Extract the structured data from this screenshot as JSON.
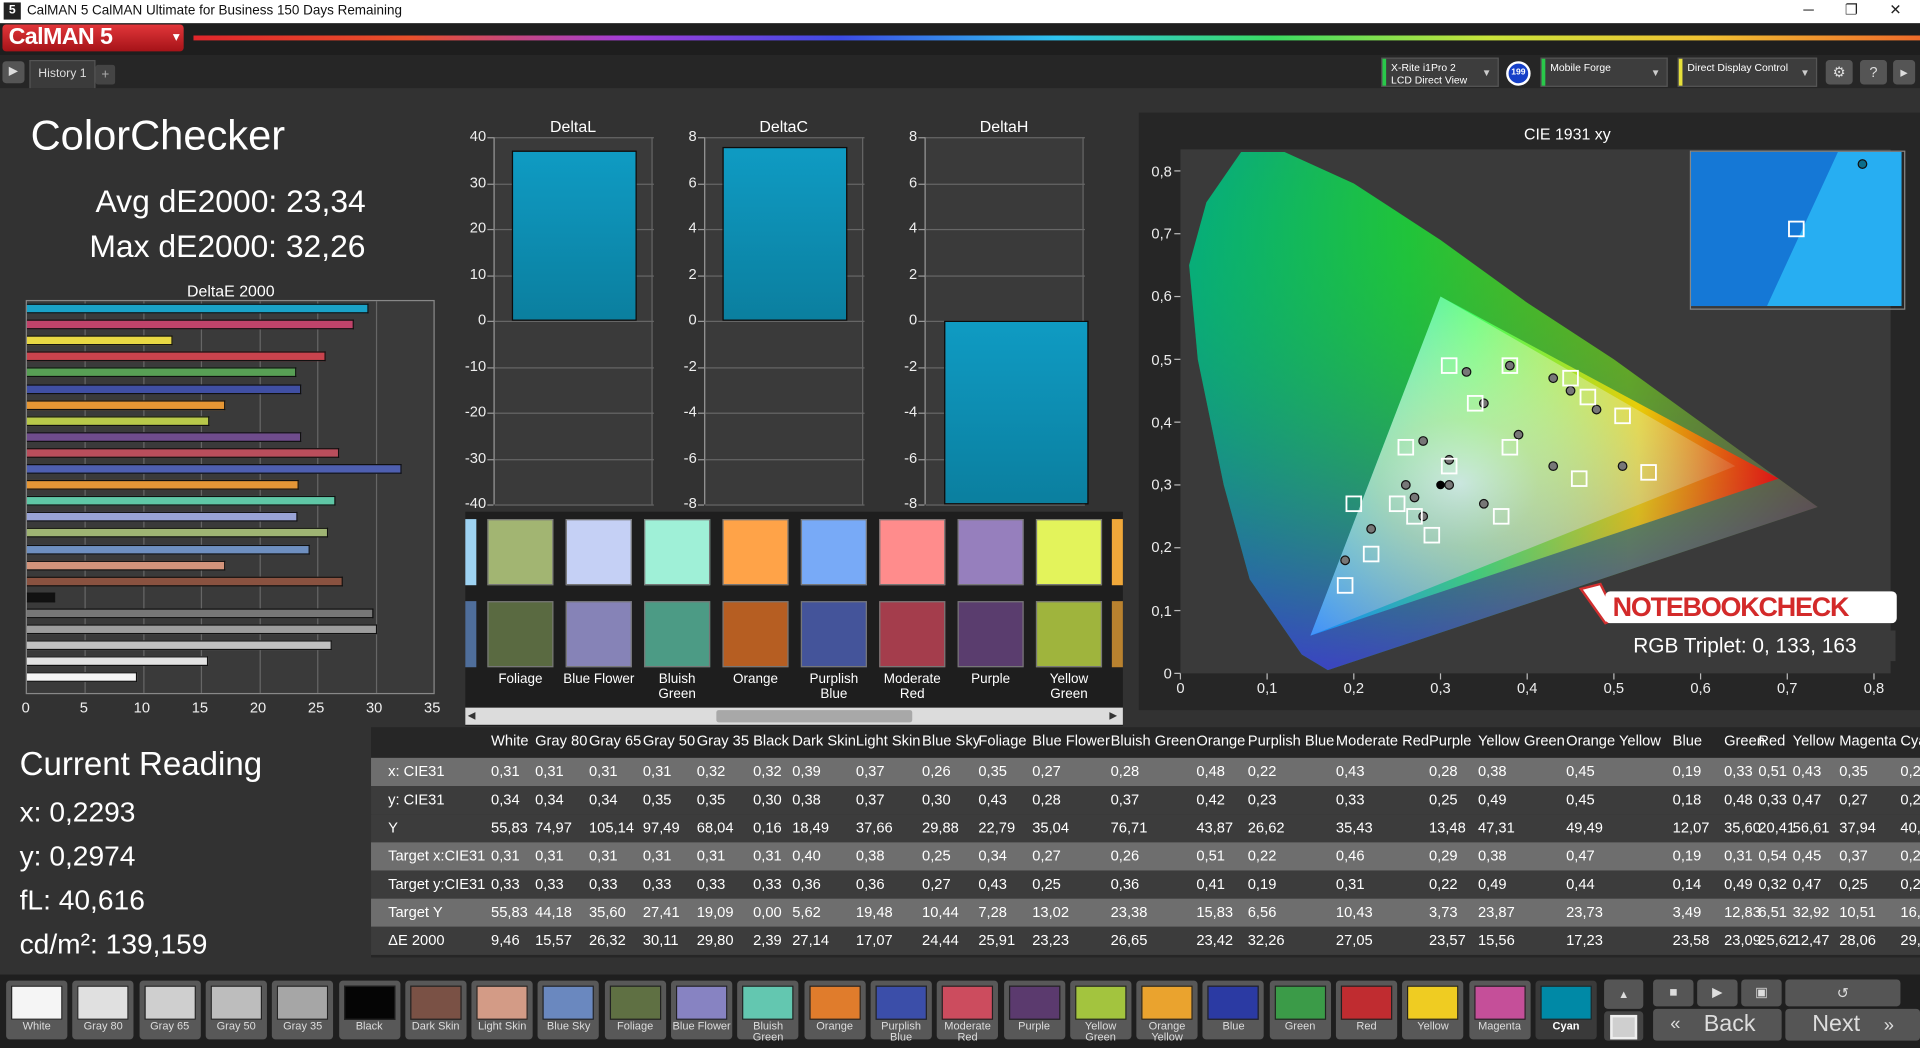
{
  "window": {
    "title": "CalMAN 5 CalMAN Ultimate for Business 150 Days Remaining",
    "minimize": "─",
    "maximize": "❐",
    "close": "✕"
  },
  "brand": {
    "name": "CalMAN 5",
    "dropdown": "▾"
  },
  "tabs": {
    "play": "▶",
    "history": "History 1",
    "add": "+"
  },
  "devices": [
    {
      "line1": "X-Rite i1Pro 2",
      "line2": "LCD Direct View",
      "color": "#29c94a"
    },
    {
      "line1": "Mobile Forge",
      "line2": "",
      "color": "#29c94a"
    },
    {
      "line1": "Direct Display Control",
      "line2": "",
      "color": "#e6e03a"
    }
  ],
  "device_badge": "199",
  "toolbar_icons": {
    "settings": "⚙",
    "help": "?",
    "expand": "▸"
  },
  "page": {
    "title": "ColorChecker",
    "avg": "Avg dE2000: 23,34",
    "max": "Max dE2000: 32,26"
  },
  "current_reading": {
    "title": "Current Reading",
    "x": "x: 0,2293",
    "y": "y: 0,2974",
    "fl": "fL: 40,616",
    "cd": "cd/m²: 139,159"
  },
  "colors": {
    "accent_bar": "#0f9bc3",
    "brand_red": "#d8262c",
    "selected": "#0089a6"
  },
  "deltae_chart": {
    "type": "bar",
    "title": "DeltaE 2000",
    "xlim": [
      0,
      35
    ],
    "xticks": [
      "0",
      "5",
      "10",
      "15",
      "20",
      "25",
      "30",
      "35"
    ],
    "values": [
      29.4,
      28.1,
      12.5,
      25.7,
      23.2,
      23.6,
      17.1,
      15.7,
      23.6,
      26.9,
      32.3,
      23.4,
      26.6,
      23.3,
      25.9,
      24.4,
      17.1,
      27.2,
      2.39,
      29.8,
      30.1,
      26.3,
      15.6,
      9.5
    ],
    "bar_colors": [
      "#1aa2c7",
      "#c0436a",
      "#e8d844",
      "#c9434d",
      "#58a055",
      "#404fa3",
      "#e69634",
      "#b8c84a",
      "#6f4c8c",
      "#b94e5c",
      "#4e5fb0",
      "#e59636",
      "#5fc7a6",
      "#99a3d6",
      "#9fb473",
      "#6e8fc0",
      "#d4947b",
      "#8a5240",
      "#111111",
      "#777777",
      "#9d9d9d",
      "#c0c0c0",
      "#e2e2e2",
      "#f5f5f5"
    ]
  },
  "chart_data": [
    {
      "type": "bar",
      "title": "DeltaL",
      "categories": [
        "Cyan"
      ],
      "values": [
        37
      ],
      "ylim": [
        -40,
        40
      ],
      "yticks": [
        "40",
        "30",
        "20",
        "10",
        "0",
        "-10",
        "-20",
        "-30",
        "-40"
      ]
    },
    {
      "type": "bar",
      "title": "DeltaC",
      "categories": [
        "Cyan"
      ],
      "values": [
        7.6
      ],
      "ylim": [
        -8,
        8
      ],
      "yticks": [
        "8",
        "6",
        "4",
        "2",
        "0",
        "-2",
        "-4",
        "-6",
        "-8"
      ]
    },
    {
      "type": "bar",
      "title": "DeltaH",
      "categories": [
        "Cyan"
      ],
      "values": [
        -8
      ],
      "ylim": [
        -8,
        8
      ],
      "yticks": [
        "8",
        "6",
        "4",
        "2",
        "0",
        "-2",
        "-4",
        "-6",
        "-8"
      ]
    }
  ],
  "cie": {
    "title": "CIE 1931 xy",
    "xticks": [
      "0",
      "0,1",
      "0,2",
      "0,3",
      "0,4",
      "0,5",
      "0,6",
      "0,7",
      "0,8"
    ],
    "yticks": [
      "0,8",
      "0,7",
      "0,6",
      "0,5",
      "0,4",
      "0,3",
      "0,2",
      "0,1",
      "0"
    ],
    "targets": [
      [
        0.31,
        0.33
      ],
      [
        0.38,
        0.36
      ],
      [
        0.25,
        0.27
      ],
      [
        0.34,
        0.43
      ],
      [
        0.27,
        0.25
      ],
      [
        0.26,
        0.36
      ],
      [
        0.51,
        0.41
      ],
      [
        0.22,
        0.19
      ],
      [
        0.46,
        0.31
      ],
      [
        0.29,
        0.22
      ],
      [
        0.38,
        0.49
      ],
      [
        0.47,
        0.44
      ],
      [
        0.19,
        0.14
      ],
      [
        0.31,
        0.49
      ],
      [
        0.54,
        0.32
      ],
      [
        0.45,
        0.47
      ],
      [
        0.37,
        0.25
      ],
      [
        0.2,
        0.27
      ]
    ],
    "measured": [
      [
        0.31,
        0.34
      ],
      [
        0.39,
        0.38
      ],
      [
        0.26,
        0.3
      ],
      [
        0.35,
        0.43
      ],
      [
        0.27,
        0.28
      ],
      [
        0.28,
        0.37
      ],
      [
        0.48,
        0.42
      ],
      [
        0.22,
        0.23
      ],
      [
        0.43,
        0.33
      ],
      [
        0.28,
        0.25
      ],
      [
        0.38,
        0.49
      ],
      [
        0.45,
        0.45
      ],
      [
        0.19,
        0.18
      ],
      [
        0.33,
        0.48
      ],
      [
        0.51,
        0.33
      ],
      [
        0.43,
        0.47
      ],
      [
        0.35,
        0.27
      ],
      [
        0.31,
        0.3
      ]
    ],
    "gamut_target": [
      [
        0.64,
        0.33
      ],
      [
        0.3,
        0.6
      ],
      [
        0.15,
        0.06
      ]
    ],
    "gamut_measured": [
      [
        0.69,
        0.31
      ],
      [
        0.3,
        0.6
      ],
      [
        0.15,
        0.06
      ]
    ]
  },
  "zoom_points": {
    "target": "□",
    "measured": "●"
  },
  "watermark": {
    "brand": "NOTEBOOKCHECK",
    "rgb": "RGB Triplet: 0, 133, 163"
  },
  "swatches_top": [
    {
      "color": "#a2b572",
      "label": "Foliage"
    },
    {
      "color": "#c5d0f5",
      "label": "Blue Flower"
    },
    {
      "color": "#9ff0d7",
      "label": "Bluish Green"
    },
    {
      "color": "#ffa348",
      "label": "Orange"
    },
    {
      "color": "#78aaf7",
      "label": "Purplish Blue"
    },
    {
      "color": "#ff8c8c",
      "label": "Moderate Red"
    },
    {
      "color": "#967fbd",
      "label": "Purple"
    },
    {
      "color": "#e3f35b",
      "label": "Yellow Green"
    }
  ],
  "swatches_bottom": [
    {
      "color": "#5a6a41",
      "label": "Foliage"
    },
    {
      "color": "#8683b7",
      "label": "Blue Flower"
    },
    {
      "color": "#4c9b85",
      "label": "Bluish Green"
    },
    {
      "color": "#b65e22",
      "label": "Orange"
    },
    {
      "color": "#44549a",
      "label": "Purplish Blue"
    },
    {
      "color": "#a43d4c",
      "label": "Moderate Red"
    },
    {
      "color": "#5a3d6e",
      "label": "Purple"
    },
    {
      "color": "#9fb43d",
      "label": "Yellow Green"
    }
  ],
  "table": {
    "headers": [
      "White",
      "Gray 80",
      "Gray 65",
      "Gray 50",
      "Gray 35",
      "Black",
      "Dark Skin",
      "Light Skin",
      "Blue Sky",
      "Foliage",
      "Blue Flower",
      "Bluish Green",
      "Orange",
      "Purplish Blue",
      "Moderate Red",
      "Purple",
      "Yellow Green",
      "Orange Yellow",
      "Blue",
      "Green",
      "Red",
      "Yellow",
      "Magenta",
      "Cya"
    ],
    "rows": [
      {
        "label": "x: CIE31",
        "values": [
          "0,31",
          "0,31",
          "0,31",
          "0,31",
          "0,32",
          "0,32",
          "0,39",
          "0,37",
          "0,26",
          "0,35",
          "0,27",
          "0,28",
          "0,48",
          "0,22",
          "0,43",
          "0,28",
          "0,38",
          "0,45",
          "0,19",
          "0,33",
          "0,51",
          "0,43",
          "0,35",
          "0,2"
        ]
      },
      {
        "label": "y: CIE31",
        "values": [
          "0,34",
          "0,34",
          "0,34",
          "0,35",
          "0,35",
          "0,30",
          "0,38",
          "0,37",
          "0,30",
          "0,43",
          "0,28",
          "0,37",
          "0,42",
          "0,23",
          "0,33",
          "0,25",
          "0,49",
          "0,45",
          "0,18",
          "0,48",
          "0,33",
          "0,47",
          "0,27",
          "0,2"
        ]
      },
      {
        "label": "Y",
        "values": [
          "55,83",
          "74,97",
          "105,14",
          "97,49",
          "68,04",
          "0,16",
          "18,49",
          "37,66",
          "29,88",
          "22,79",
          "35,04",
          "76,71",
          "43,87",
          "26,62",
          "35,43",
          "13,48",
          "47,31",
          "49,49",
          "12,07",
          "35,60",
          "20,41",
          "56,61",
          "37,94",
          "40,"
        ]
      },
      {
        "label": "Target x:CIE31",
        "values": [
          "0,31",
          "0,31",
          "0,31",
          "0,31",
          "0,31",
          "0,31",
          "0,40",
          "0,38",
          "0,25",
          "0,34",
          "0,27",
          "0,26",
          "0,51",
          "0,22",
          "0,46",
          "0,29",
          "0,38",
          "0,47",
          "0,19",
          "0,31",
          "0,54",
          "0,45",
          "0,37",
          "0,2"
        ]
      },
      {
        "label": "Target y:CIE31",
        "values": [
          "0,33",
          "0,33",
          "0,33",
          "0,33",
          "0,33",
          "0,33",
          "0,36",
          "0,36",
          "0,27",
          "0,43",
          "0,25",
          "0,36",
          "0,41",
          "0,19",
          "0,31",
          "0,22",
          "0,49",
          "0,44",
          "0,14",
          "0,49",
          "0,32",
          "0,47",
          "0,25",
          "0,2"
        ]
      },
      {
        "label": "Target Y",
        "values": [
          "55,83",
          "44,18",
          "35,60",
          "27,41",
          "19,09",
          "0,00",
          "5,62",
          "19,48",
          "10,44",
          "7,28",
          "13,02",
          "23,38",
          "15,83",
          "6,56",
          "10,43",
          "3,73",
          "23,87",
          "23,73",
          "3,49",
          "12,83",
          "6,51",
          "32,92",
          "10,51",
          "16,"
        ]
      },
      {
        "label": "ΔE 2000",
        "values": [
          "9,46",
          "15,57",
          "26,32",
          "30,11",
          "29,80",
          "2,39",
          "27,14",
          "17,07",
          "24,44",
          "25,91",
          "23,23",
          "26,65",
          "23,42",
          "32,26",
          "27,05",
          "23,57",
          "15,56",
          "17,23",
          "23,58",
          "23,09",
          "25,62",
          "12,47",
          "28,06",
          "29,"
        ]
      }
    ]
  },
  "bottom_swatches": [
    {
      "label": "White",
      "color": "#f5f5f5"
    },
    {
      "label": "Gray 80",
      "color": "#e0e0e0"
    },
    {
      "label": "Gray 65",
      "color": "#cfcfcf"
    },
    {
      "label": "Gray 50",
      "color": "#bdbdbd"
    },
    {
      "label": "Gray 35",
      "color": "#a6a6a6"
    },
    {
      "label": "Black",
      "color": "#050505"
    },
    {
      "label": "Dark Skin",
      "color": "#7a5145"
    },
    {
      "label": "Light Skin",
      "color": "#d39b86"
    },
    {
      "label": "Blue Sky",
      "color": "#6a88bf"
    },
    {
      "label": "Foliage",
      "color": "#5f7043"
    },
    {
      "label": "Blue Flower",
      "color": "#8783c2"
    },
    {
      "label": "Bluish Green",
      "color": "#63c7b0"
    },
    {
      "label": "Orange",
      "color": "#e07c2c"
    },
    {
      "label": "Purplish Blue",
      "color": "#3b4ea9"
    },
    {
      "label": "Moderate Red",
      "color": "#cc4c5e"
    },
    {
      "label": "Purple",
      "color": "#5b3a6e"
    },
    {
      "label": "Yellow Green",
      "color": "#a3c43e"
    },
    {
      "label": "Orange Yellow",
      "color": "#eaa32e"
    },
    {
      "label": "Blue",
      "color": "#2b3aa3"
    },
    {
      "label": "Green",
      "color": "#3b9b48"
    },
    {
      "label": "Red",
      "color": "#c02c30"
    },
    {
      "label": "Yellow",
      "color": "#efcc22"
    },
    {
      "label": "Magenta",
      "color": "#c54f99"
    },
    {
      "label": "Cyan",
      "color": "#0089a6"
    }
  ],
  "nav": {
    "back": "Back",
    "next": "Next",
    "back_icon": "«",
    "next_icon": "»",
    "stop": "■",
    "play": "▶",
    "save": "💾",
    "undo": "↺",
    "up": "▲",
    "down": "▼"
  }
}
